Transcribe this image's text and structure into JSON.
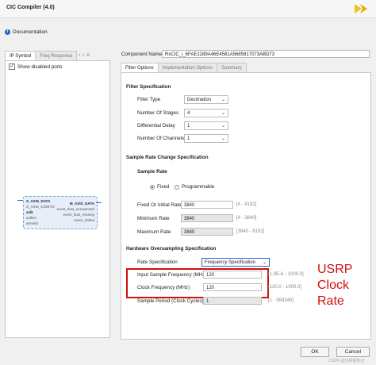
{
  "window": {
    "title": "CIC Compiler (4.0)"
  },
  "documentation_label": "Documentation",
  "left_panel": {
    "tabs": [
      "IP Symbol",
      "Freq Response"
    ],
    "show_disabled_ports_label": "Show disabled ports",
    "show_disabled_ports_checked": true,
    "symbol": {
      "left_ports": [
        "S_AXIS_DATA",
        "S_AXIS_CONFIG",
        "aclk",
        "aclken",
        "aresetn"
      ],
      "right_ports": [
        "M_AXIS_DATA",
        "event_tlast_unexpected",
        "event_tlast_missing",
        "event_halted"
      ]
    }
  },
  "right_panel": {
    "component_name_label": "Component Name",
    "component_name_value": "RxCIC_i_6FAE1289A46E4581A5685817073ABD73",
    "tabs": [
      "Filter Options",
      "Implementation Options",
      "Summary"
    ],
    "filter_spec": {
      "heading": "Filter Specification",
      "rows": [
        {
          "label": "Filter Type",
          "value": "Decimation"
        },
        {
          "label": "Number Of Stages",
          "value": "4"
        },
        {
          "label": "Differential Delay",
          "value": "1"
        },
        {
          "label": "Number Of Channels",
          "value": "1"
        }
      ]
    },
    "rate_change": {
      "heading": "Sample Rate Change Specification",
      "sample_rate_heading": "Sample Rate",
      "fixed_label": "Fixed",
      "programmable_label": "Programmable",
      "fixed_selected": true,
      "rows": [
        {
          "label": "Fixed Or Initial Rate",
          "value": "3840",
          "range": "[4 - 8192]",
          "readonly": false
        },
        {
          "label": "Minimum Rate",
          "value": "3840",
          "range": "[4 - 3840]",
          "readonly": true
        },
        {
          "label": "Maximum Rate",
          "value": "3840",
          "range": "[3840 - 8192]",
          "readonly": true
        }
      ]
    },
    "oversampling": {
      "heading": "Hardware Oversampling Specification",
      "rate_spec_label": "Rate Specification",
      "rate_spec_value": "Frequency Specification",
      "rows": [
        {
          "label": "Input Sample Frequency (MHz)",
          "value": "120",
          "range": "[1.0E-6 - 1000.0]"
        },
        {
          "label": "Clock Frequency (MHz)",
          "value": "120",
          "range": "[120.0 - 1000.0]"
        }
      ],
      "sample_period_label": "Sample Period (Clock Cycles)",
      "sample_period_value": "1",
      "sample_period_range": "[1 - 559240]"
    }
  },
  "annotation": {
    "line1": "USRP",
    "line2": "Clock",
    "line3": "Rate",
    "color": "#d20f0f"
  },
  "footer": {
    "ok_label": "OK",
    "cancel_label": "Cancel",
    "watermark": "CSDN @比特超标记"
  },
  "colors": {
    "logo_yellow": "#f0c419",
    "highlight_red": "#d20f0f",
    "selected_blue": "#2a62c9"
  }
}
